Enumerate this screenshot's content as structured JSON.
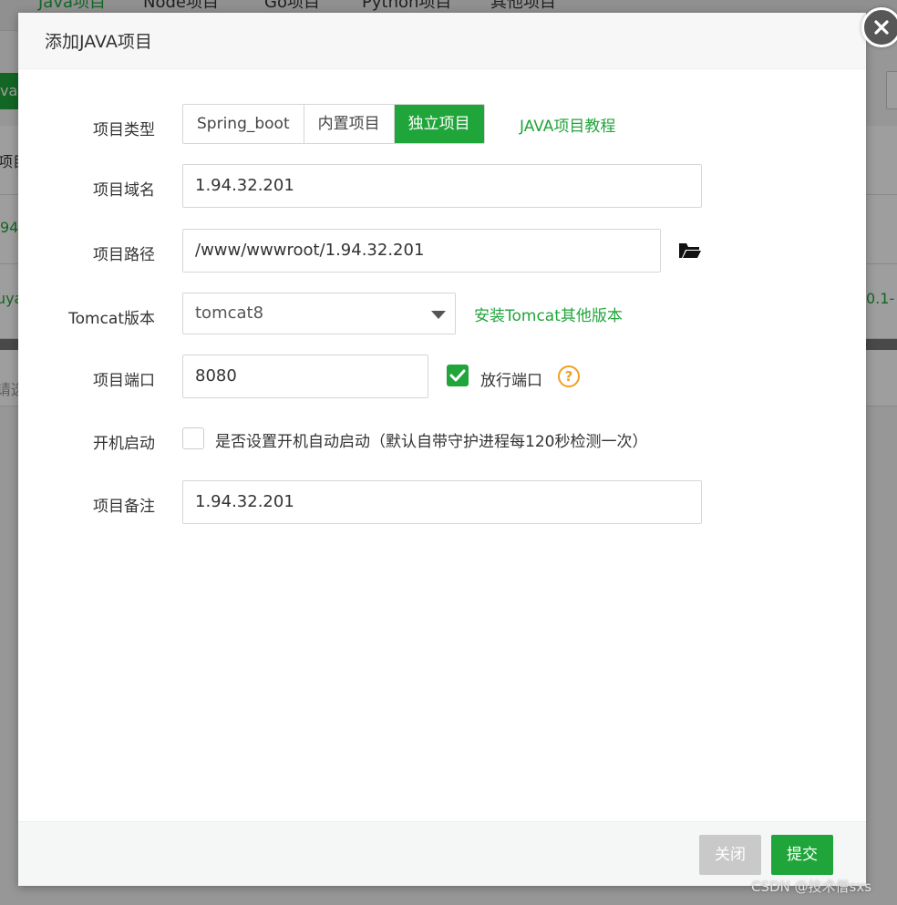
{
  "background": {
    "tabs": [
      "Java项目",
      "Node项目",
      "Go项目",
      "Python项目",
      "其他项目"
    ],
    "left_button_fragment": "va项",
    "row_fragments": [
      "项目",
      "94",
      "uya",
      "0.1-"
    ],
    "search_fragment": "请选"
  },
  "dialog": {
    "title": "添加JAVA项目",
    "project_type": {
      "label": "项目类型",
      "options": [
        "Spring_boot",
        "内置项目",
        "独立项目"
      ],
      "selected": "独立项目",
      "tutorial_link": "JAVA项目教程"
    },
    "domain": {
      "label": "项目域名",
      "value": "1.94.32.201"
    },
    "path": {
      "label": "项目路径",
      "value": "/www/wwwroot/1.94.32.201",
      "icon": "folder-open-icon"
    },
    "tomcat": {
      "label": "Tomcat版本",
      "selected": "tomcat8",
      "install_link": "安装Tomcat其他版本"
    },
    "port": {
      "label": "项目端口",
      "value": "8080",
      "release_label": "放行端口",
      "release_checked": true,
      "help": "?"
    },
    "autostart": {
      "label": "开机启动",
      "checked": false,
      "description": "是否设置开机自动启动（默认自带守护进程每120秒检测一次）"
    },
    "remark": {
      "label": "项目备注",
      "value": "1.94.32.201"
    },
    "buttons": {
      "close": "关闭",
      "submit": "提交"
    }
  },
  "watermark": "CSDN @技术僧sxs",
  "colors": {
    "accent": "#20a53a",
    "help": "#f0a020",
    "close_button": "#c9c9c9"
  }
}
